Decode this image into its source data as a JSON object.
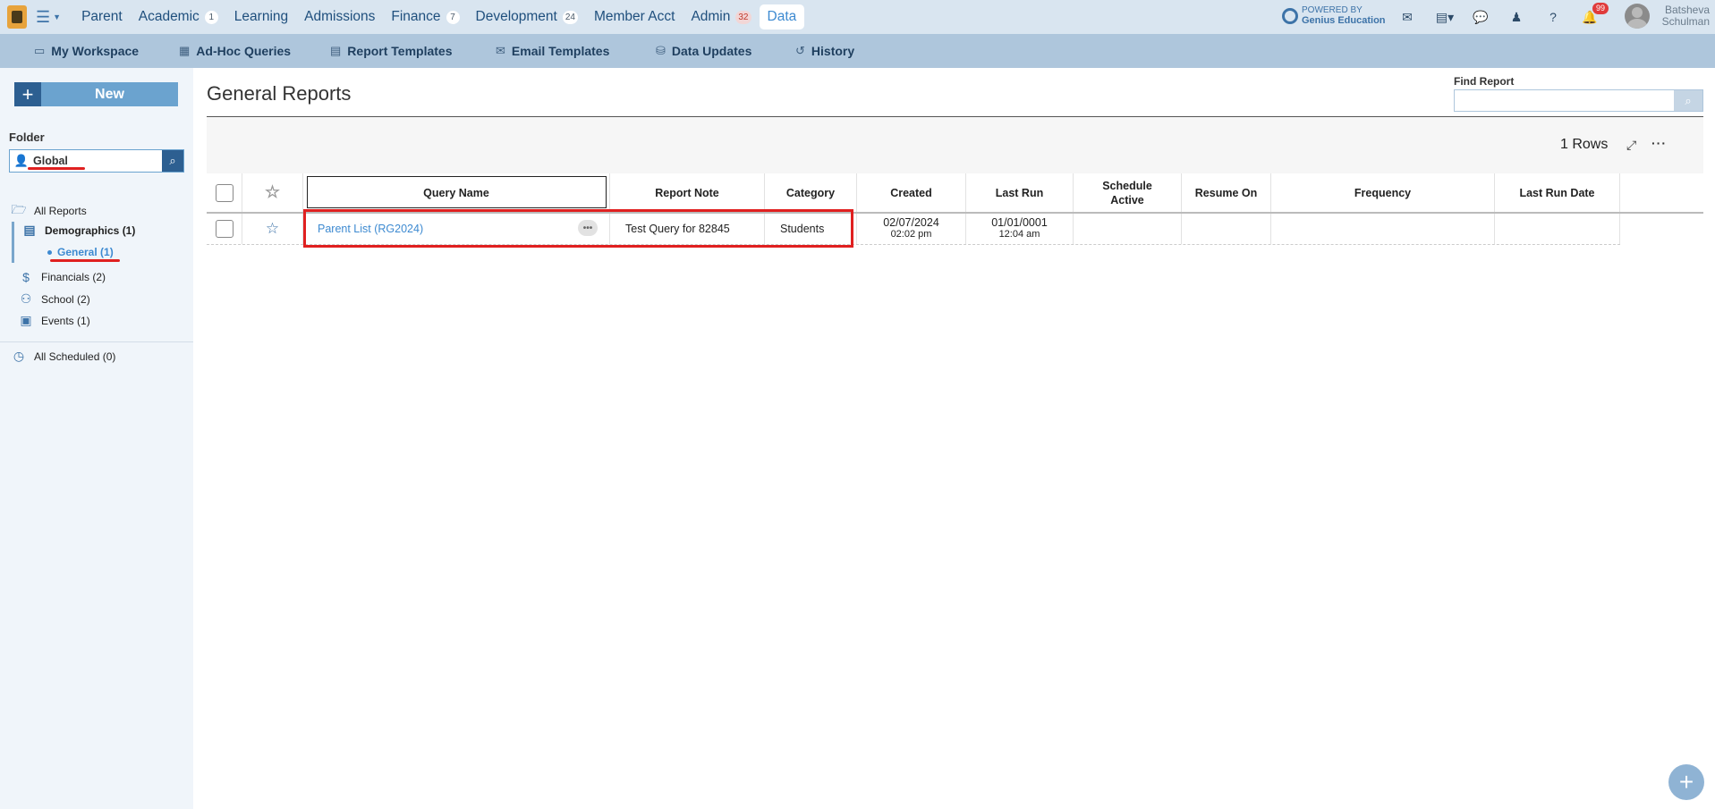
{
  "topnav": {
    "items": [
      {
        "label": "Parent",
        "badge": ""
      },
      {
        "label": "Academic",
        "badge": "1"
      },
      {
        "label": "Learning",
        "badge": ""
      },
      {
        "label": "Admissions",
        "badge": ""
      },
      {
        "label": "Finance",
        "badge": "7"
      },
      {
        "label": "Development",
        "badge": "24"
      },
      {
        "label": "Member Acct",
        "badge": ""
      },
      {
        "label": "Admin",
        "badge": "32"
      },
      {
        "label": "Data",
        "badge": ""
      }
    ],
    "active": "Data",
    "powered_by_line1": "POWERED BY",
    "powered_by_line2": "Genius Education",
    "notifications_count": "99",
    "user_first": "Batsheva",
    "user_last": "Schulman"
  },
  "subnav": {
    "items": [
      {
        "label": "My Workspace",
        "icon": "folder-icon"
      },
      {
        "label": "Ad-Hoc Queries",
        "icon": "grid-icon"
      },
      {
        "label": "Report Templates",
        "icon": "document-icon"
      },
      {
        "label": "Email Templates",
        "icon": "email-template-icon"
      },
      {
        "label": "Data Updates",
        "icon": "database-icon"
      },
      {
        "label": "History",
        "icon": "history-icon"
      }
    ]
  },
  "sidebar": {
    "new_label": "New",
    "folder_label": "Folder",
    "folder_value": "Global",
    "tree": {
      "all_reports": "All Reports",
      "demographics": "Demographics (1)",
      "general": "General (1)",
      "financials": "Financials (2)",
      "school": "School (2)",
      "events": "Events (1)",
      "all_scheduled": "All Scheduled (0)"
    }
  },
  "main": {
    "title": "General Reports",
    "find_label": "Find Report",
    "find_value": "",
    "rows_count": "1 Rows",
    "columns": {
      "query_name": "Query Name",
      "report_note": "Report Note",
      "category": "Category",
      "created": "Created",
      "last_run": "Last Run",
      "schedule_active_1": "Schedule",
      "schedule_active_2": "Active",
      "resume_on": "Resume On",
      "frequency": "Frequency",
      "last_run_date": "Last Run Date"
    },
    "rows": [
      {
        "query_name": "Parent List (RG2024)",
        "report_note": "Test Query for 82845",
        "category": "Students",
        "created_date": "02/07/2024",
        "created_time": "02:02 pm",
        "last_run_date": "01/01/0001",
        "last_run_time": "12:04 am",
        "schedule_active": "",
        "resume_on": "",
        "frequency": "",
        "last_run_date_col": ""
      }
    ]
  },
  "colors": {
    "topbar": "#d9e5f0",
    "subbar": "#aec6dc",
    "sidebar": "#f0f5fa",
    "accent": "#3d8ad1",
    "annotation_red": "#e02020"
  }
}
